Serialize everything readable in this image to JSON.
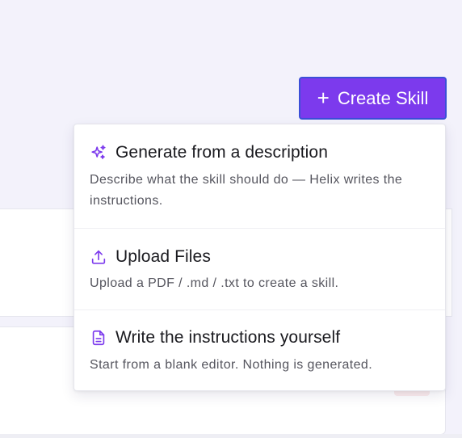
{
  "header": {
    "create_button": {
      "icon": "plus-icon",
      "label": "Create Skill"
    }
  },
  "create_menu": {
    "items": [
      {
        "icon": "sparkles-icon",
        "title": "Generate from a description",
        "description": "Describe what the skill should do — Helix writes the instructions."
      },
      {
        "icon": "upload-icon",
        "title": "Upload Files",
        "description": "Upload a PDF / .md / .txt to create a skill."
      },
      {
        "icon": "document-icon",
        "title": "Write the instructions yourself",
        "description": "Start from a blank editor. Nothing is generated."
      }
    ]
  },
  "colors": {
    "accent": "#7c3aed",
    "button_border": "#3b4fd8",
    "page_background": "#f3f2fb",
    "menu_icon": "#7c3aed"
  }
}
